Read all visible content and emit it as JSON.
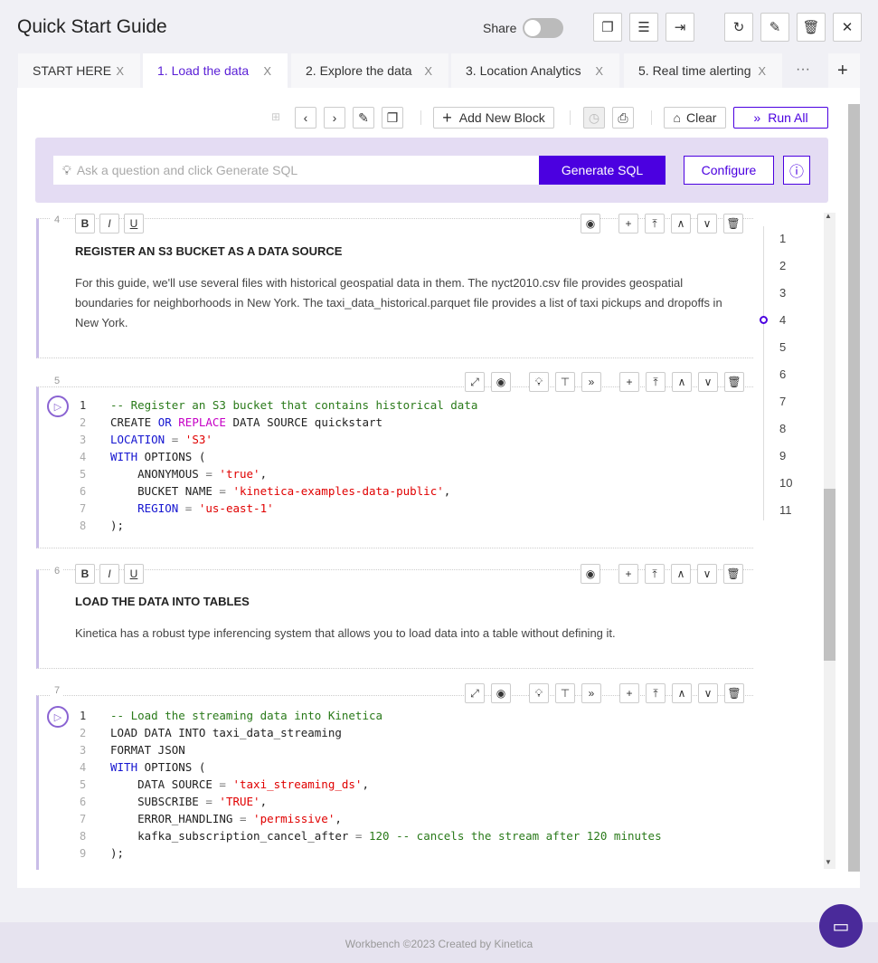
{
  "header": {
    "title": "Quick Start Guide",
    "share_label": "Share",
    "share_on": false,
    "icons": [
      "copy-icon",
      "layout-icon",
      "export-icon",
      "refresh-icon",
      "edit-icon",
      "trash-icon",
      "close-icon"
    ]
  },
  "tabs": [
    {
      "label": "START HERE",
      "active": false
    },
    {
      "label": "1. Load the data",
      "active": true
    },
    {
      "label": "2. Explore the data",
      "active": false
    },
    {
      "label": "3. Location Analytics",
      "active": false
    },
    {
      "label": "5. Real time alerting",
      "active": false
    }
  ],
  "tabs_more": "···",
  "tabs_add": "+",
  "tab_close": "X",
  "toolbar": {
    "add_block": "Add New Block",
    "clear": "Clear",
    "run_all": "Run All"
  },
  "ai": {
    "placeholder": "Ask a question and click Generate SQL",
    "generate": "Generate SQL",
    "configure": "Configure",
    "accent": "#4b00e0"
  },
  "cells": {
    "c4": {
      "num": "4",
      "heading": "REGISTER AN S3 BUCKET AS A DATA SOURCE",
      "text": "For this guide, we'll use several files with historical geospatial data in them. The nyct2010.csv file provides geospatial boundaries for neighborhoods in New York. The taxi_data_historical.parquet file provides a list of taxi pickups and dropoffs in New York."
    },
    "c5": {
      "num": "5",
      "lines": [
        [
          [
            "-- Register an S3 bucket that contains historical data",
            "cm"
          ]
        ],
        [
          [
            "CREATE ",
            ""
          ],
          [
            "OR ",
            "kw"
          ],
          [
            "REPLACE ",
            "kw2"
          ],
          [
            "DATA SOURCE quickstart",
            ""
          ]
        ],
        [
          [
            "LOCATION",
            "kw"
          ],
          [
            " = ",
            "op"
          ],
          [
            "'S3'",
            "str"
          ]
        ],
        [
          [
            "WITH ",
            "kw"
          ],
          [
            "OPTIONS (",
            ""
          ]
        ],
        [
          [
            "    ANONYMOUS",
            ""
          ],
          [
            " = ",
            "op"
          ],
          [
            "'true'",
            "str"
          ],
          [
            ",",
            ""
          ]
        ],
        [
          [
            "    BUCKET NAME",
            ""
          ],
          [
            " = ",
            "op"
          ],
          [
            "'kinetica-examples-data-public'",
            "str"
          ],
          [
            ",",
            ""
          ]
        ],
        [
          [
            "    REGION",
            "kw"
          ],
          [
            " = ",
            "op"
          ],
          [
            "'us-east-1'",
            "str"
          ]
        ],
        [
          [
            ");",
            ""
          ]
        ]
      ]
    },
    "c6": {
      "num": "6",
      "heading": "LOAD THE DATA INTO TABLES",
      "text": "Kinetica has a robust type inferencing system that allows you to load data into a table without defining it."
    },
    "c7": {
      "num": "7",
      "lines": [
        [
          [
            "-- Load the streaming data into Kinetica",
            "cm"
          ]
        ],
        [
          [
            "LOAD DATA INTO taxi_data_streaming",
            ""
          ]
        ],
        [
          [
            "FORMAT JSON",
            ""
          ]
        ],
        [
          [
            "WITH ",
            "kw"
          ],
          [
            "OPTIONS (",
            ""
          ]
        ],
        [
          [
            "    DATA SOURCE",
            ""
          ],
          [
            " = ",
            "op"
          ],
          [
            "'taxi_streaming_ds'",
            "str"
          ],
          [
            ",",
            ""
          ]
        ],
        [
          [
            "    SUBSCRIBE",
            ""
          ],
          [
            " = ",
            "op"
          ],
          [
            "'TRUE'",
            "str"
          ],
          [
            ",",
            ""
          ]
        ],
        [
          [
            "    ERROR_HANDLING",
            ""
          ],
          [
            " = ",
            "op"
          ],
          [
            "'permissive'",
            "str"
          ],
          [
            ",",
            ""
          ]
        ],
        [
          [
            "    kafka_subscription_cancel_after",
            ""
          ],
          [
            " = ",
            "op"
          ],
          [
            "120 ",
            "cm"
          ],
          [
            "-- cancels the stream after 120 minutes",
            "cm"
          ]
        ],
        [
          [
            ");",
            ""
          ]
        ]
      ]
    }
  },
  "outline": {
    "items": [
      "1",
      "2",
      "3",
      "4",
      "5",
      "6",
      "7",
      "8",
      "9",
      "10",
      "11"
    ],
    "current": "4"
  },
  "footer": {
    "text": "Workbench ©2023 Created by Kinetica"
  }
}
